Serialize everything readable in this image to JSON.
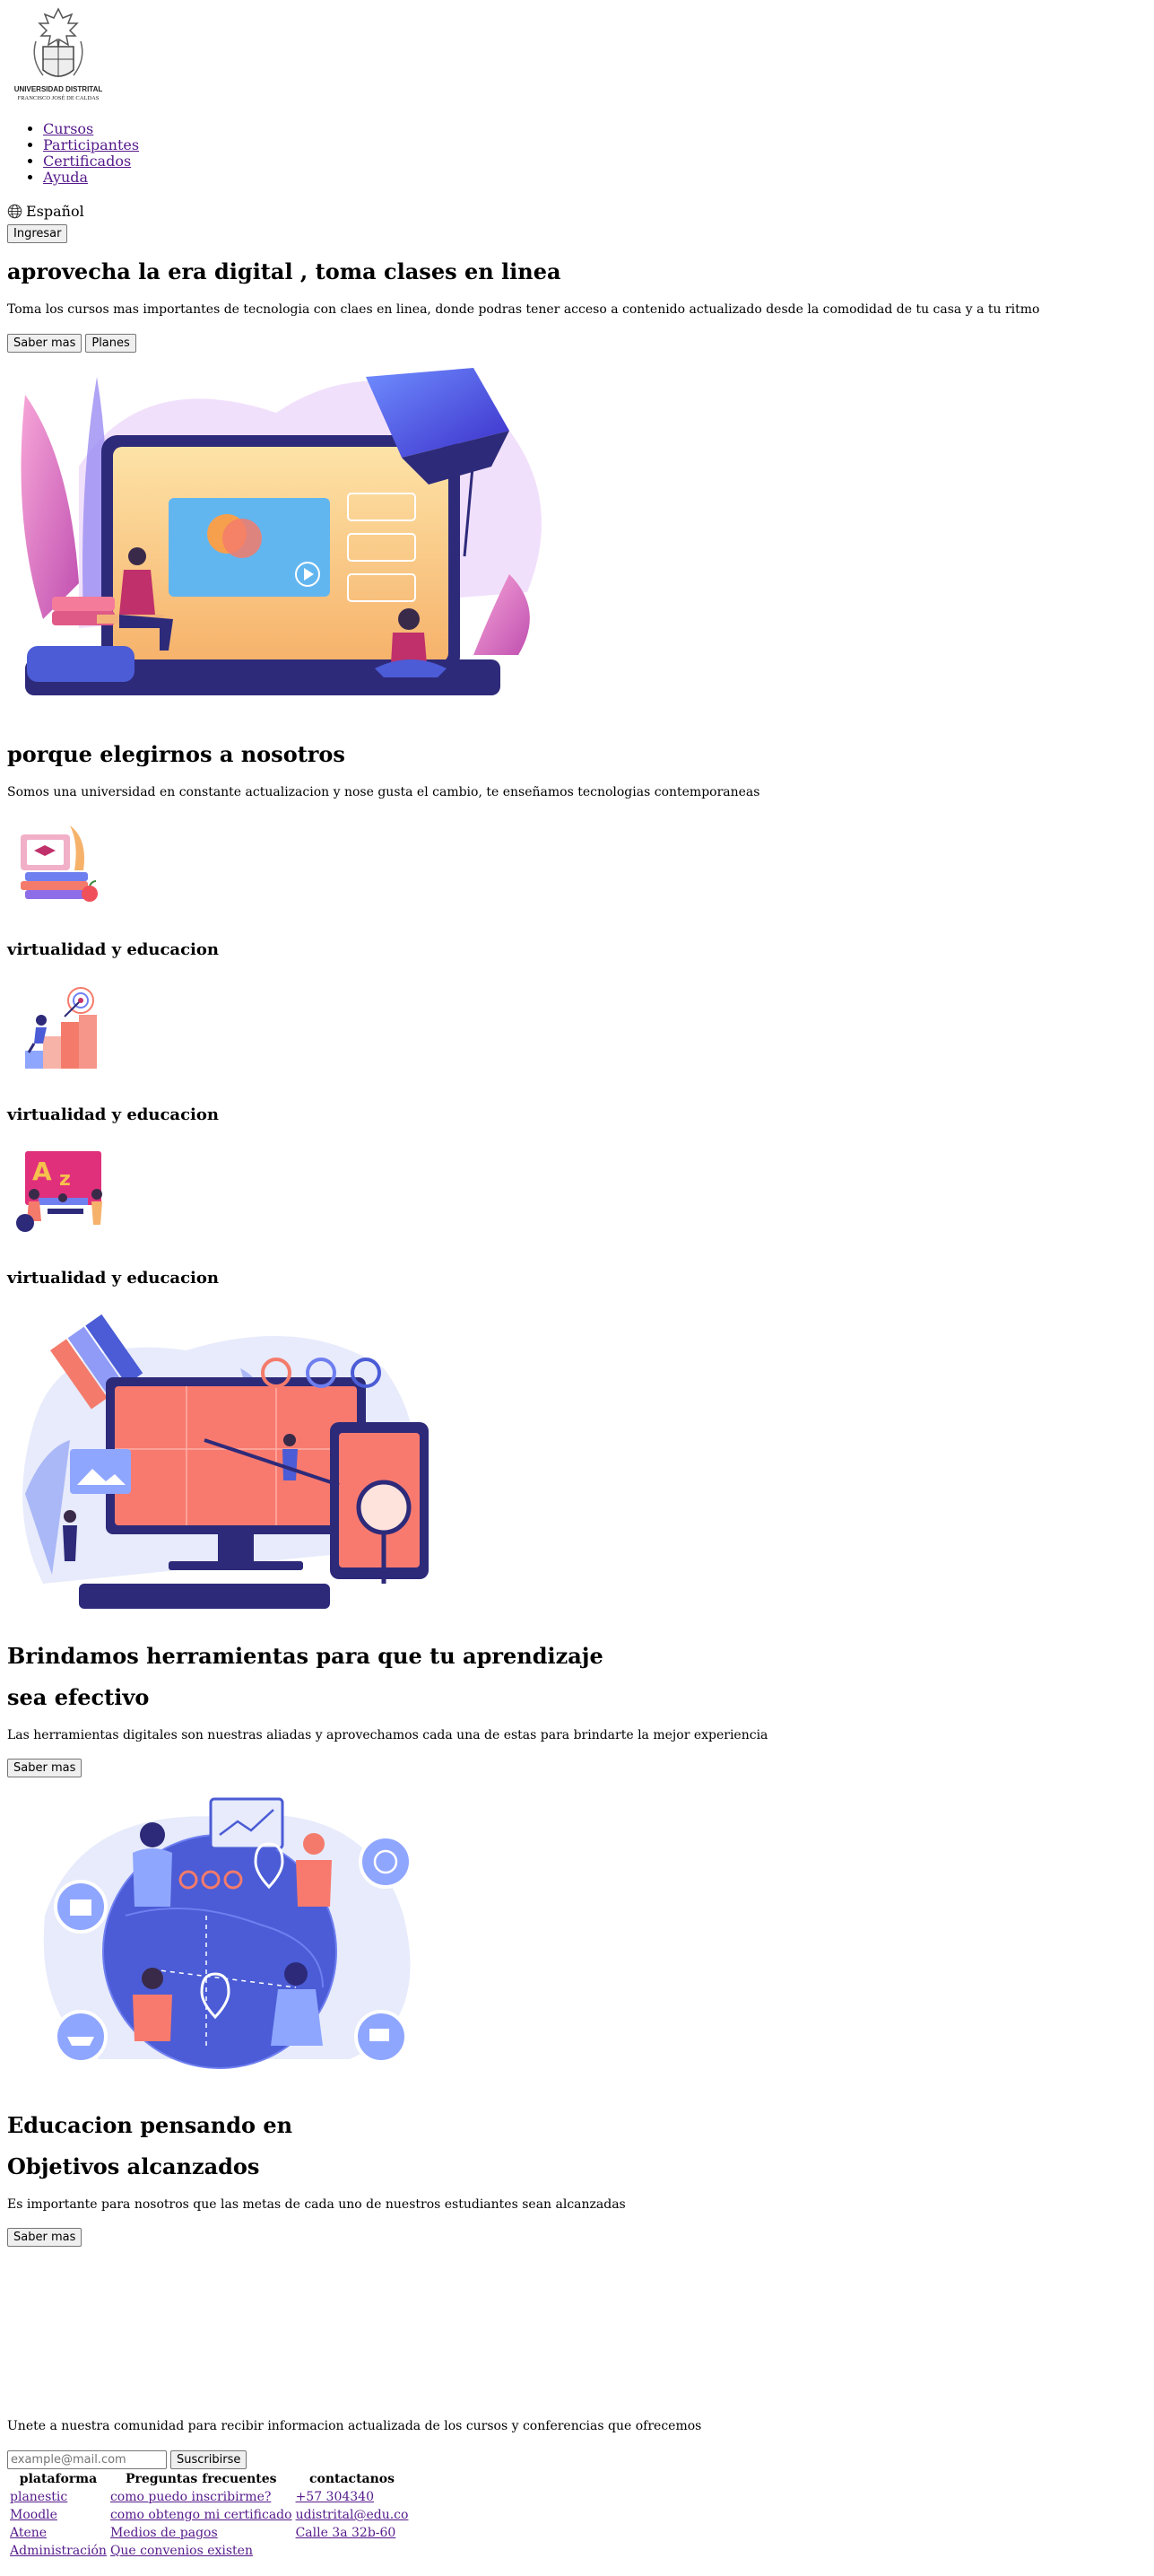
{
  "header": {
    "logo_line1": "UNIVERSIDAD DISTRITAL",
    "logo_line2": "FRANCISCO JOSÉ DE CALDAS",
    "nav": [
      "Cursos",
      "Participantes",
      "Certificados",
      "Ayuda"
    ],
    "language": "Español",
    "language_icon": "globe-icon",
    "login_label": "Ingresar"
  },
  "hero": {
    "title": "aprovecha la era digital , toma clases en linea",
    "description": "Toma los cursos mas importantes de tecnologia con claes en linea, donde podras tener acceso a contenido actualizado desde la comodidad de tu casa y a tu ritmo",
    "btn_more": "Saber mas",
    "btn_plans": "Planes"
  },
  "why": {
    "title": "porque elegirnos a nosotros",
    "description": "Somos una universidad en constante actualizacion y nose gusta el cambio, te enseñamos tecnologias contemporaneas",
    "features": [
      {
        "title": "virtualidad y educacion",
        "icon": "books-graduation-icon"
      },
      {
        "title": "virtualidad y educacion",
        "icon": "target-stairs-icon"
      },
      {
        "title": "virtualidad y educacion",
        "icon": "alphabet-class-icon"
      }
    ]
  },
  "tools": {
    "title1": "Brindamos herramientas para que tu aprendizaje",
    "title2": "sea efectivo",
    "description": "Las herramientas digitales son nuestras aliadas y aprovechamos cada una de estas para brindarte la mejor experiencia",
    "btn": "Saber mas"
  },
  "goals": {
    "title1": "Educacion pensando en",
    "title2": "Objetivos alcanzados",
    "description": "Es importante para nosotros que las metas de cada uno de nuestros estudiantes sean alcanzadas",
    "btn": "Saber mas"
  },
  "newsletter": {
    "description": "Unete a nuestra comunidad para recibir informacion actualizada de los cursos y conferencias que ofrecemos",
    "placeholder": "example@mail.com",
    "btn": "Suscribirse"
  },
  "footer": {
    "headers": [
      "plataforma",
      "Preguntas frecuentes",
      "contactanos"
    ],
    "rows": [
      [
        "planestic",
        "como puedo inscribirme?",
        "+57 304340"
      ],
      [
        "Moodle",
        "como obtengo mi certificado",
        "udistrital@edu.co"
      ],
      [
        "Atene",
        "Medios de pagos",
        "Calle 3a 32b-60"
      ],
      [
        "Administración",
        "Que convenios existen",
        ""
      ]
    ]
  },
  "colors": {
    "link": "#551a8b",
    "illustration_purple": "#6c5ce7",
    "illustration_navy": "#2d2a7a",
    "illustration_coral": "#f87a6e",
    "illustration_yellow": "#f7c96b"
  }
}
